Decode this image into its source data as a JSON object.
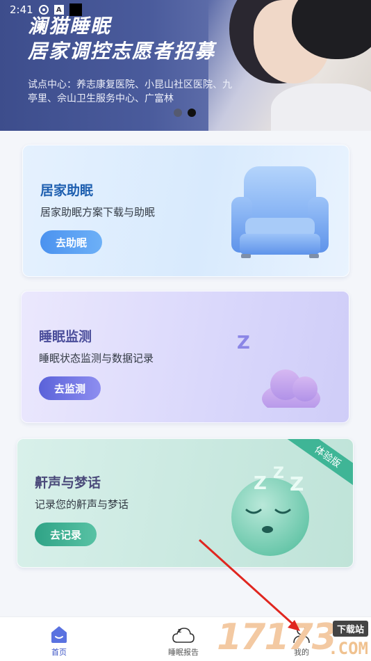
{
  "status_bar": {
    "time": "2:41",
    "app_icon_letter": "A"
  },
  "banner": {
    "title_line1": "澜猫睡眠",
    "title_line2": "居家调控志愿者招募",
    "subtitle": "试点中心：养志康复医院、小昆山社区医院、九亭里、佘山卫生服务中心、广富林",
    "carousel_pages": 2,
    "carousel_active_index": 1
  },
  "cards": [
    {
      "title": "居家助眠",
      "description": "居家助眠方案下载与助眠",
      "button": "去助眠",
      "icon": "armchair-icon",
      "accent": "#4b92ef"
    },
    {
      "title": "睡眠监测",
      "description": "睡眠状态监测与数据记录",
      "button": "去监测",
      "icon": "moon-cloud-icon",
      "accent": "#5a62d9"
    },
    {
      "title": "鼾声与梦话",
      "description": "记录您的鼾声与梦话",
      "button": "去记录",
      "icon": "sleeping-face-icon",
      "ribbon": "体验版",
      "accent": "#2fa386"
    }
  ],
  "bottom_nav": {
    "items": [
      {
        "label": "首页",
        "icon": "home-icon",
        "active": true
      },
      {
        "label": "睡眠报告",
        "icon": "sleep-report-icon",
        "active": false
      },
      {
        "label": "我的",
        "icon": "profile-icon",
        "active": false
      }
    ]
  },
  "watermark": {
    "digits": "17173",
    "badge": "下载站",
    "suffix": ".COM"
  }
}
